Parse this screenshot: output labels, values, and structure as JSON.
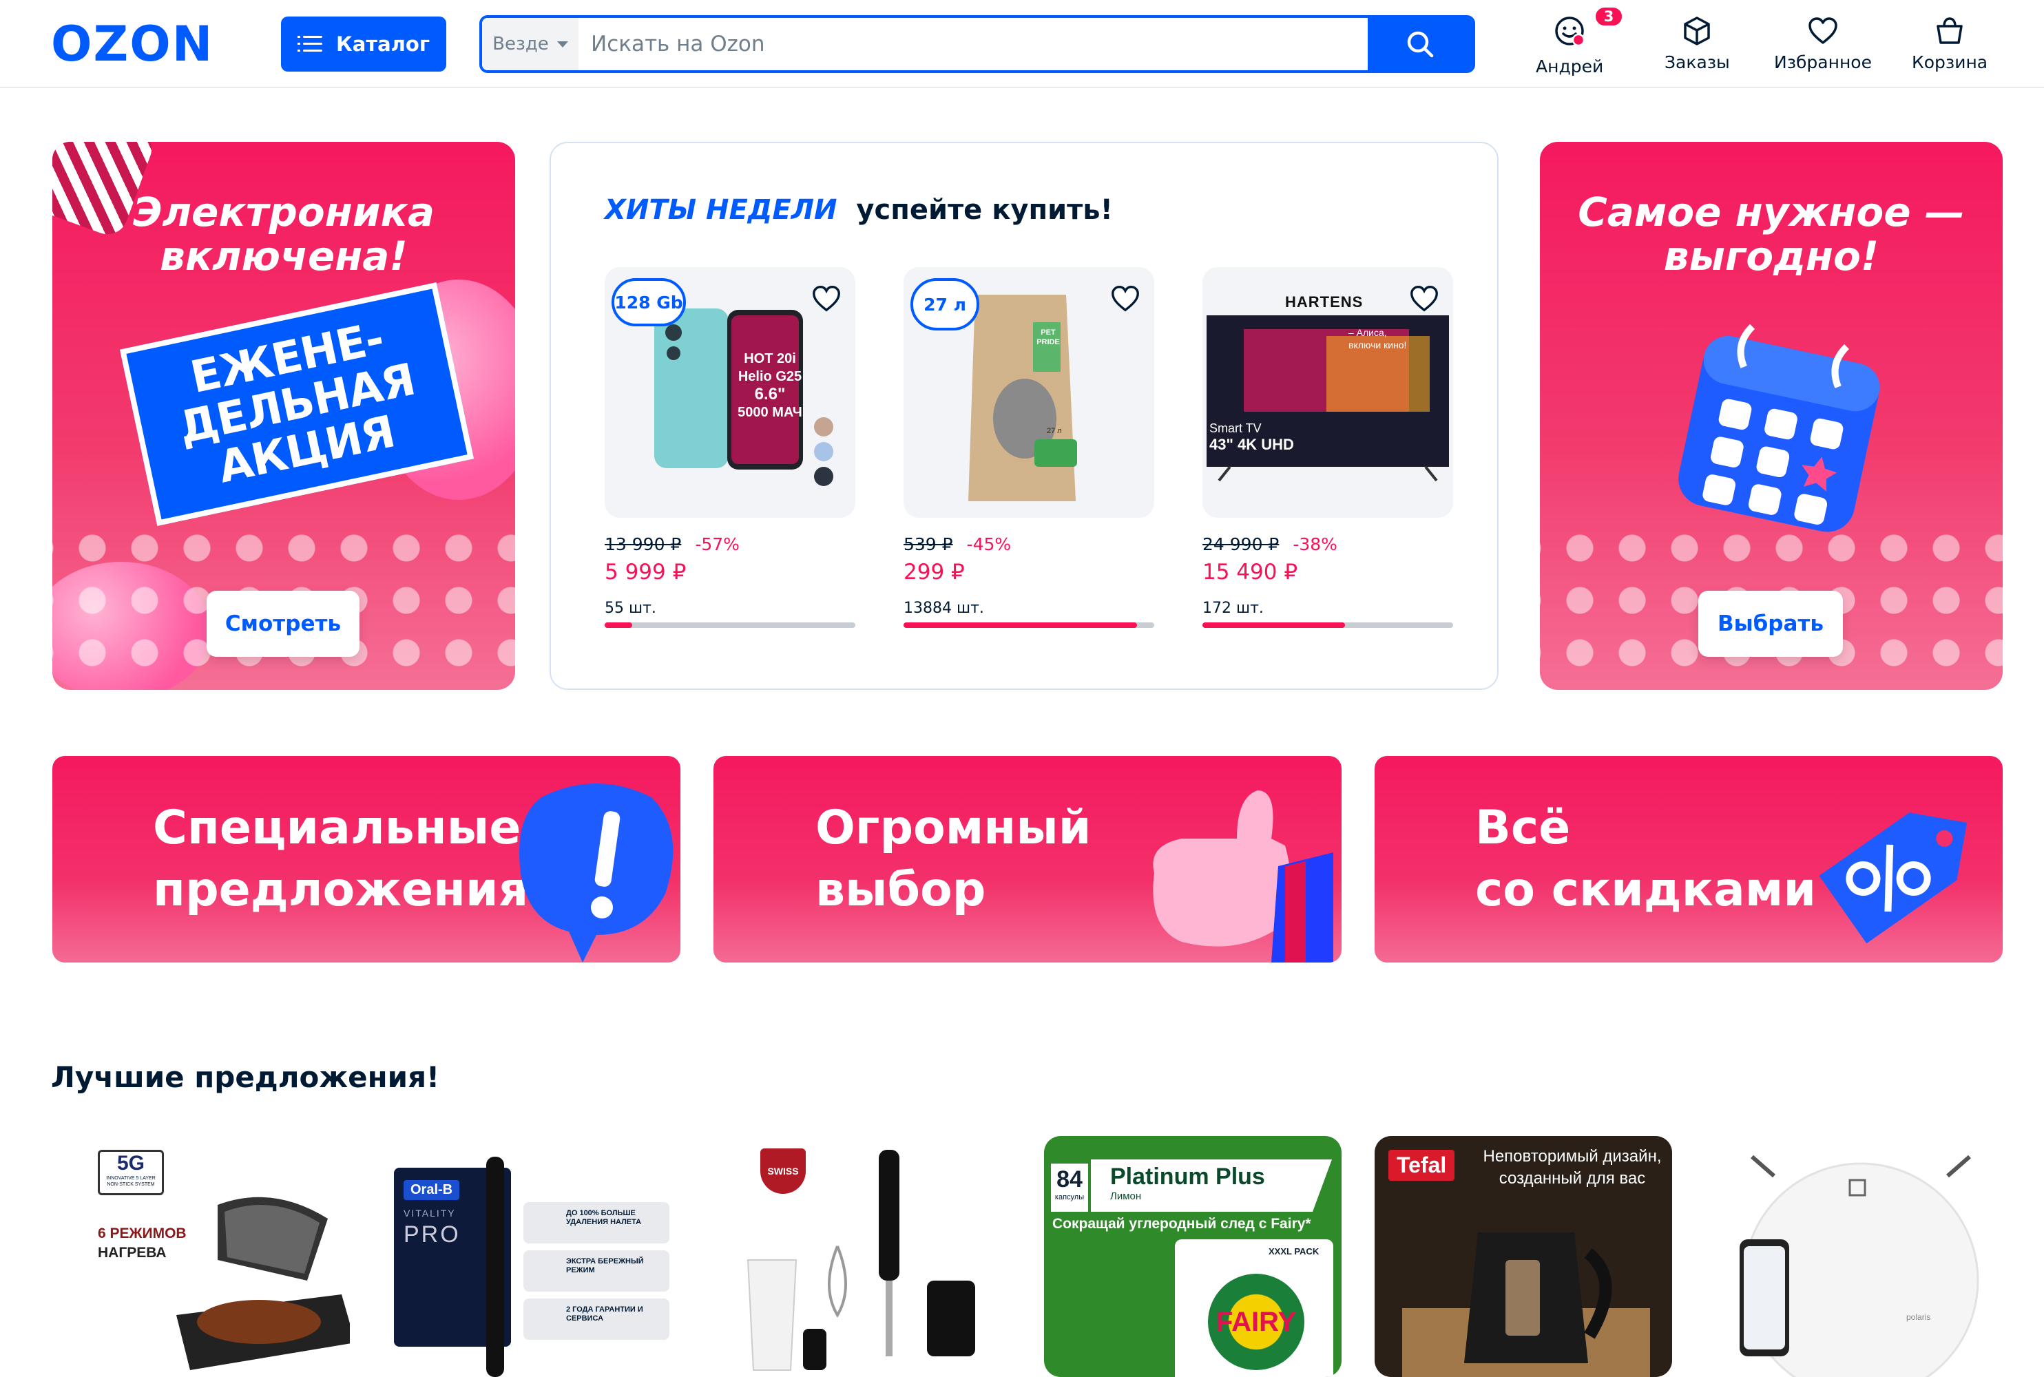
{
  "header": {
    "logo": "OZON",
    "catalog_label": "Каталог",
    "search": {
      "scope": "Везде",
      "placeholder": "Искать на Ozon"
    },
    "nav": [
      {
        "label": "Андрей",
        "icon": "profile-icon",
        "badge": "3"
      },
      {
        "label": "Заказы",
        "icon": "box-icon"
      },
      {
        "label": "Избранное",
        "icon": "heart-icon"
      },
      {
        "label": "Корзина",
        "icon": "basket-icon"
      }
    ]
  },
  "banners": {
    "left": {
      "title_line1": "Электроника",
      "title_line2": "включена!",
      "promo_line1": "ЕЖЕНЕ-",
      "promo_line2": "ДЕЛЬНАЯ",
      "promo_line3": "АКЦИЯ",
      "button": "Смотреть"
    },
    "right": {
      "title_line1": "Самое нужное —",
      "title_line2": "выгодно!",
      "button": "Выбрать"
    }
  },
  "hits": {
    "tag": "ХИТЫ НЕДЕЛИ",
    "subtitle": "успейте купить!",
    "products": [
      {
        "chip": "128 Gb",
        "image_text": [
          "HOT 20i",
          "Helio G25",
          "6.6\"",
          "5000 МАЧ"
        ],
        "old_price": "13 990 ₽",
        "discount": "-57%",
        "price": "5 999 ₽",
        "qty": "55 шт.",
        "sold_fraction": 0.11
      },
      {
        "chip": "27 л",
        "image_text": [
          "PET",
          "PRIDE",
          "27 л"
        ],
        "old_price": "539 ₽",
        "discount": "-45%",
        "price": "299 ₽",
        "qty": "13884 шт.",
        "sold_fraction": 0.93
      },
      {
        "brand": "HARTENS",
        "image_text": [
          "– Алиса,",
          "включи кино!",
          "Smart TV",
          "43\" 4K UHD"
        ],
        "old_price": "24 990 ₽",
        "discount": "-38%",
        "price": "15 490 ₽",
        "qty": "172 шт.",
        "sold_fraction": 0.57
      }
    ]
  },
  "tiles": [
    {
      "line1": "Специальные",
      "line2": "предложения"
    },
    {
      "line1": "Огромный",
      "line2": "выбор"
    },
    {
      "line1": "Всё",
      "line2": "со скидками"
    }
  ],
  "best": {
    "title": "Лучшие предложения!",
    "cards": [
      {
        "name": "grill-card",
        "texts": [
          "5G",
          "INNOVATIVE 5 LAYER NON-STICK SYSTEM",
          "6 РЕЖИМОВ",
          "НАГРЕВА"
        ]
      },
      {
        "name": "toothbrush-card",
        "texts": [
          "Oral-B",
          "VITALITY",
          "PRO",
          "ДО 100% БОЛЬШЕ УДАЛЕНИЯ НАЛЕТА",
          "ЭКСТРА БЕРЕЖНЫЙ РЕЖИМ",
          "2 ГОДА ГАРАНТИИ И СЕРВИСА"
        ]
      },
      {
        "name": "blender-card",
        "texts": [
          "SWISS"
        ]
      },
      {
        "name": "fairy-card",
        "texts": [
          "84",
          "капсулы",
          "Platinum Plus",
          "Лимон",
          "Сокращай углеродный след с Fairy*",
          "XXXL PACK",
          "FAIRY"
        ]
      },
      {
        "name": "kettle-card",
        "texts": [
          "Tefal",
          "Неповторимый дизайн,",
          "созданный для вас"
        ]
      },
      {
        "name": "robot-vacuum-card",
        "texts": [
          "polaris"
        ]
      }
    ]
  },
  "colors": {
    "brand": "#005bff",
    "accent": "#f91155",
    "promo": "#f5195f"
  }
}
